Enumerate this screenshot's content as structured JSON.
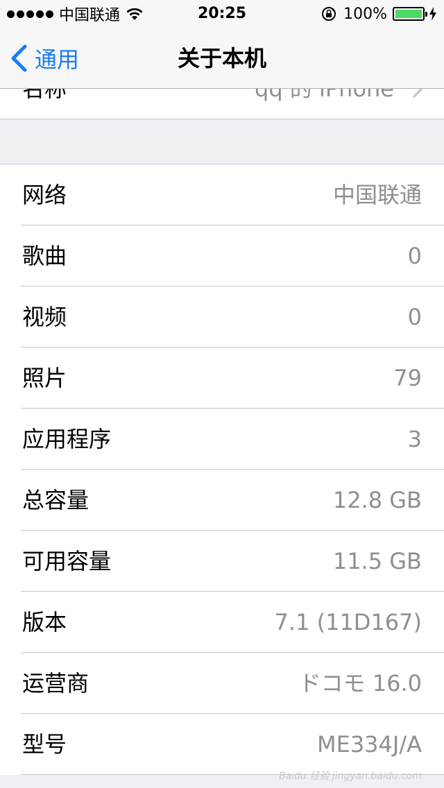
{
  "status_bar": {
    "carrier": "中国联通",
    "time": "20:25",
    "battery_percent": "100%",
    "battery_level": 1.0,
    "battery_color": "#4cd964"
  },
  "nav": {
    "back_label": "通用",
    "title": "关于本机",
    "tint_color": "#1a7cf2"
  },
  "partial_row": {
    "label": "名称",
    "value": "qq 的 iPhone"
  },
  "rows": [
    {
      "label": "网络",
      "value": "中国联通"
    },
    {
      "label": "歌曲",
      "value": "0"
    },
    {
      "label": "视频",
      "value": "0"
    },
    {
      "label": "照片",
      "value": "79"
    },
    {
      "label": "应用程序",
      "value": "3"
    },
    {
      "label": "总容量",
      "value": "12.8 GB"
    },
    {
      "label": "可用容量",
      "value": "11.5 GB"
    },
    {
      "label": "版本",
      "value": "7.1 (11D167)"
    },
    {
      "label": "运营商",
      "value": "ドコモ 16.0"
    },
    {
      "label": "型号",
      "value": "ME334J/A"
    }
  ],
  "watermark": "Baidu 经验 jingyan.baidu.com"
}
